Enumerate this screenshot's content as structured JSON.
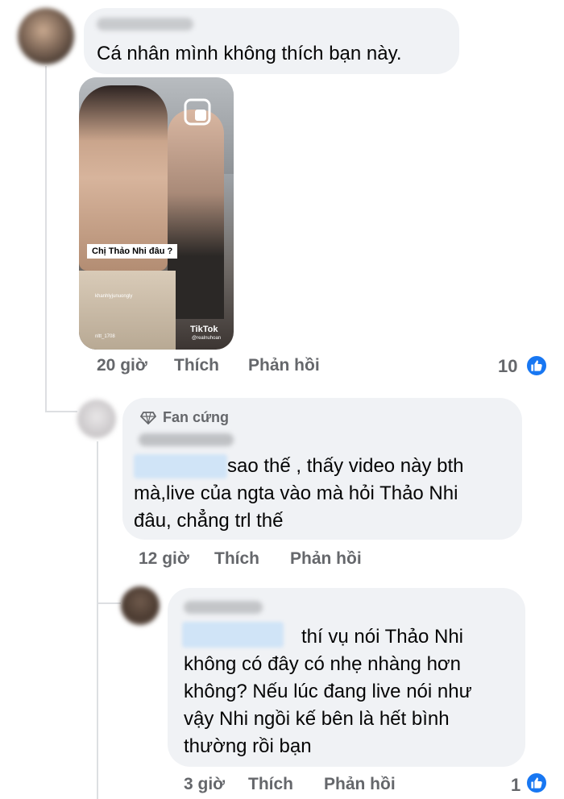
{
  "comments": [
    {
      "text": "Cá nhân mình không thích bạn này.",
      "time": "20 giờ",
      "like_label": "Thích",
      "reply_label": "Phản hồi",
      "reactions": "10",
      "media": {
        "overlay_text": "Chị Thảo Nhi đâu ?",
        "username": "khanhlyjunuongly",
        "username_small": "nltt_1708",
        "logo": "TikTok",
        "handle": "@realnuhoan"
      }
    },
    {
      "badge": "Fan cứng",
      "text": "sao thế , thấy video này bth\nmà,live của ngta vào mà hỏi Thảo Nhi\nđâu, chẳng trl thế",
      "time": "12 giờ",
      "like_label": "Thích",
      "reply_label": "Phản hồi"
    },
    {
      "text": "thí vụ nói Thảo Nhi\nkhông có đây có nhẹ nhàng hơn\nkhông? Nếu lúc đang live nói như\nvậy Nhi ngồi kế bên là hết bình\nthường rồi bạn",
      "time": "3 giờ",
      "like_label": "Thích",
      "reply_label": "Phản hồi",
      "reactions": "1"
    }
  ],
  "icons": {
    "like": "thumbs-up-icon",
    "badge": "diamond-icon",
    "pip": "picture-in-picture-icon"
  },
  "colors": {
    "bubble": "#f0f2f5",
    "meta": "#65676b",
    "like_blue": "#1877f2",
    "thread_line": "#dddfe2"
  }
}
